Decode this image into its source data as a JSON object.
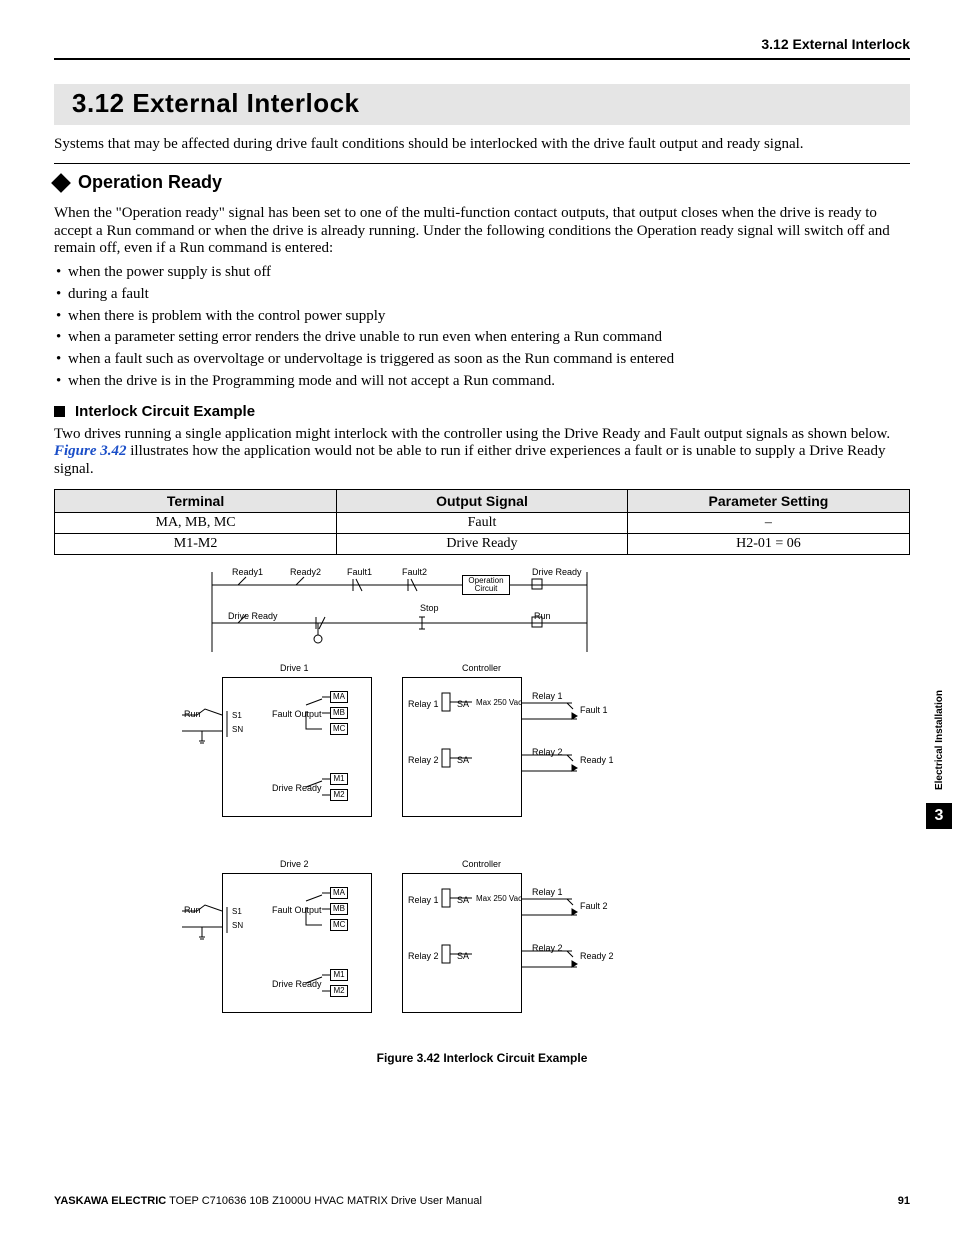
{
  "header": {
    "right": "3.12 External Interlock"
  },
  "section": {
    "number_title": "3.12  External Interlock",
    "intro": "Systems that may be affected during drive fault conditions should be interlocked with the drive fault output and ready signal."
  },
  "operation_ready": {
    "heading": "Operation Ready",
    "para": "When the \"Operation ready\" signal has been set to one of the multi-function contact outputs, that output closes when the drive is ready to accept a Run command or when the drive is already running. Under the following conditions the Operation ready signal will switch off and remain off, even if a Run command is entered:",
    "items": [
      "when the power supply is shut off",
      "during a fault",
      "when there is problem with the control power supply",
      "when a parameter setting error renders the drive unable to run even when entering a Run command",
      "when a fault such as overvoltage or undervoltage is triggered as soon as the Run command is entered",
      "when the drive is in the Programming mode and will not accept a Run command."
    ]
  },
  "interlock_example": {
    "heading": "Interlock Circuit Example",
    "para_before_ref": "Two drives running a single application might interlock with the controller using the Drive Ready and Fault output signals as shown below. ",
    "figure_ref": "Figure 3.42",
    "para_after_ref": " illustrates how the application would not be able to run if either drive experiences a fault or is unable to supply a Drive Ready signal."
  },
  "table": {
    "headers": [
      "Terminal",
      "Output Signal",
      "Parameter Setting"
    ],
    "rows": [
      [
        "MA, MB, MC",
        "Fault",
        "–"
      ],
      [
        "M1-M2",
        "Drive Ready",
        "H2-01 = 06"
      ]
    ]
  },
  "diagram": {
    "top_labels": {
      "ready1": "Ready1",
      "ready2": "Ready2",
      "fault1": "Fault1",
      "fault2": "Fault2",
      "drive_ready_left": "Drive Ready",
      "drive_ready_right": "Drive Ready",
      "stop": "Stop",
      "run": "Run",
      "op_circuit": "Operation Circuit"
    },
    "blocks": [
      {
        "title": "Drive 1",
        "controller": "Controller",
        "run": "Run",
        "s1": "S1",
        "sn": "SN",
        "fault_output": "Fault Output",
        "drive_ready": "Drive Ready",
        "ma": "MA",
        "mb": "MB",
        "mc": "MC",
        "m1": "M1",
        "m2": "M2",
        "relay1": "Relay 1",
        "relay2": "Relay 2",
        "sa": "SA",
        "max": "Max 250 Vac",
        "out_relay1": "Relay 1",
        "out_relay2": "Relay 2",
        "out_fault": "Fault 1",
        "out_ready": "Ready 1"
      },
      {
        "title": "Drive 2",
        "controller": "Controller",
        "run": "Run",
        "s1": "S1",
        "sn": "SN",
        "fault_output": "Fault Output",
        "drive_ready": "Drive Ready",
        "ma": "MA",
        "mb": "MB",
        "mc": "MC",
        "m1": "M1",
        "m2": "M2",
        "relay1": "Relay 1",
        "relay2": "Relay 2",
        "sa": "SA",
        "max": "Max 250 Vac",
        "out_relay1": "Relay 1",
        "out_relay2": "Relay 2",
        "out_fault": "Fault 2",
        "out_ready": "Ready 2"
      }
    ],
    "caption": "Figure 3.42  Interlock Circuit Example"
  },
  "side": {
    "label": "Electrical Installation",
    "chapter": "3"
  },
  "footer": {
    "brand": "YASKAWA ELECTRIC",
    "doc": " TOEP C710636 10B Z1000U HVAC MATRIX Drive User Manual",
    "page": "91"
  }
}
